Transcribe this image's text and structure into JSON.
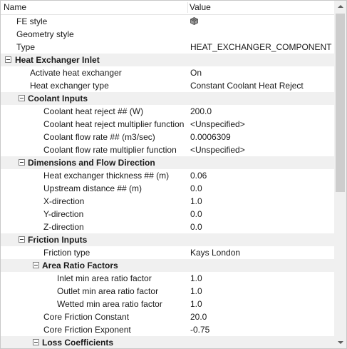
{
  "header": {
    "name_label": "Name",
    "value_label": "Value"
  },
  "rows": [
    {
      "type": "prop",
      "label": "FE style",
      "value": "",
      "icon": "cube-icon",
      "indent": 22
    },
    {
      "type": "prop",
      "label": "Geometry style",
      "value": "",
      "indent": 22
    },
    {
      "type": "prop",
      "label": "Type",
      "value": "HEAT_EXCHANGER_COMPONENT",
      "indent": 22
    },
    {
      "type": "section",
      "label": "Heat Exchanger Inlet",
      "indent": 20,
      "toggle": 6
    },
    {
      "type": "prop",
      "label": "Activate heat exchanger",
      "value": "On",
      "indent": 41
    },
    {
      "type": "prop",
      "label": "Heat exchanger type",
      "value": "Constant Coolant Heat Reject",
      "indent": 41
    },
    {
      "type": "section",
      "label": "Coolant Inputs",
      "indent": 38,
      "toggle": 25
    },
    {
      "type": "prop",
      "label": "Coolant heat reject ## (W)",
      "value": "200.0",
      "indent": 60
    },
    {
      "type": "prop",
      "label": "Coolant heat reject multiplier function",
      "value": "<Unspecified>",
      "indent": 60
    },
    {
      "type": "prop",
      "label": "Coolant flow rate ## (m3/sec)",
      "value": "0.0006309",
      "indent": 60
    },
    {
      "type": "prop",
      "label": "Coolant flow rate multiplier function",
      "value": "<Unspecified>",
      "indent": 60
    },
    {
      "type": "section",
      "label": "Dimensions and Flow Direction",
      "indent": 38,
      "toggle": 25
    },
    {
      "type": "prop",
      "label": "Heat exchanger thickness ## (m)",
      "value": "0.06",
      "indent": 60
    },
    {
      "type": "prop",
      "label": "Upstream distance ## (m)",
      "value": "0.0",
      "indent": 60
    },
    {
      "type": "prop",
      "label": "X-direction",
      "value": "1.0",
      "indent": 60
    },
    {
      "type": "prop",
      "label": "Y-direction",
      "value": "0.0",
      "indent": 60
    },
    {
      "type": "prop",
      "label": "Z-direction",
      "value": "0.0",
      "indent": 60
    },
    {
      "type": "section",
      "label": "Friction Inputs",
      "indent": 38,
      "toggle": 25
    },
    {
      "type": "prop",
      "label": "Friction type",
      "value": "Kays London",
      "indent": 60
    },
    {
      "type": "section",
      "label": "Area Ratio Factors",
      "indent": 58,
      "toggle": 45
    },
    {
      "type": "prop",
      "label": "Inlet min area ratio factor",
      "value": "1.0",
      "indent": 79
    },
    {
      "type": "prop",
      "label": "Outlet min area ratio factor",
      "value": "1.0",
      "indent": 79
    },
    {
      "type": "prop",
      "label": "Wetted min area ratio factor",
      "value": "1.0",
      "indent": 79
    },
    {
      "type": "prop",
      "label": "Core Friction Constant",
      "value": "20.0",
      "indent": 60
    },
    {
      "type": "prop",
      "label": "Core Friction Exponent",
      "value": "-0.75",
      "indent": 60
    },
    {
      "type": "section",
      "label": "Loss Coefficients",
      "indent": 58,
      "toggle": 45
    }
  ],
  "colors": {
    "section_bg": "#f0f0f0",
    "scrollbar_thumb": "#cdcdcd"
  }
}
